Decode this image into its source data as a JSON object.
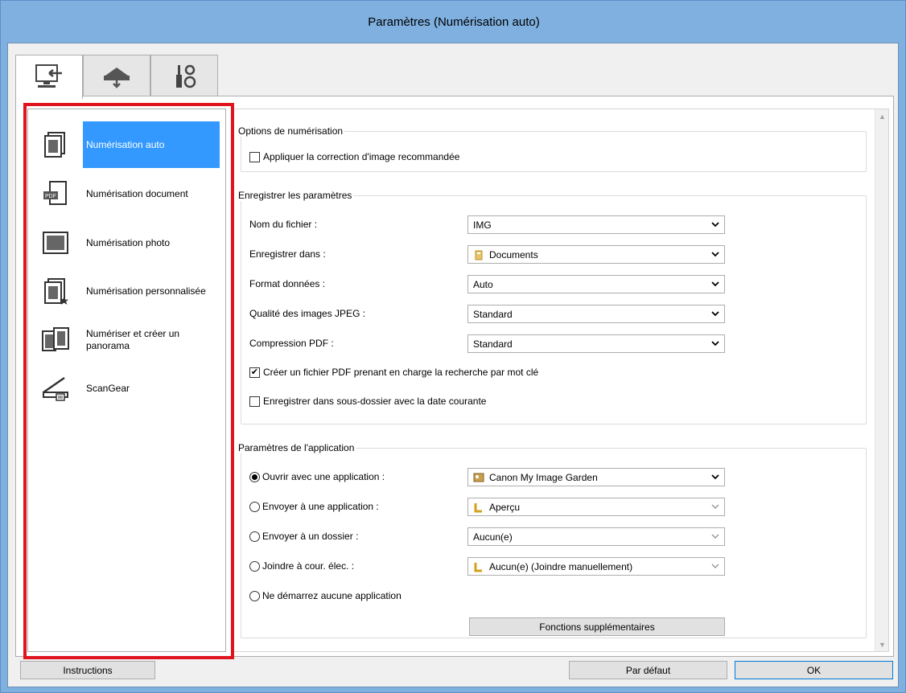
{
  "window": {
    "title": "Paramètres (Numérisation auto)"
  },
  "tabs": [
    {
      "icon": "computer-scan-icon",
      "active": true
    },
    {
      "icon": "scanner-icon",
      "active": false
    },
    {
      "icon": "tools-icon",
      "active": false
    }
  ],
  "modes": [
    {
      "label": "Numérisation auto",
      "icon": "auto-scan-icon",
      "selected": true
    },
    {
      "label": "Numérisation document",
      "icon": "document-scan-icon",
      "selected": false
    },
    {
      "label": "Numérisation photo",
      "icon": "photo-scan-icon",
      "selected": false
    },
    {
      "label": "Numérisation personnalisée",
      "icon": "custom-scan-icon",
      "selected": false
    },
    {
      "label": "Numériser et créer un panorama",
      "icon": "panorama-icon",
      "selected": false
    },
    {
      "label": "ScanGear",
      "icon": "scangear-icon",
      "selected": false
    }
  ],
  "scan_options": {
    "legend": "Options de numérisation",
    "apply_correction": {
      "label": "Appliquer la correction d'image recommandée",
      "checked": false
    }
  },
  "save_settings": {
    "legend": "Enregistrer les paramètres",
    "file_name": {
      "label": "Nom du fichier :",
      "value": "IMG"
    },
    "save_in": {
      "label": "Enregistrer dans :",
      "value": "Documents"
    },
    "data_format": {
      "label": "Format données :",
      "value": "Auto"
    },
    "jpeg_quality": {
      "label": "Qualité des images JPEG :",
      "value": "Standard"
    },
    "pdf_compression": {
      "label": "Compression PDF :",
      "value": "Standard"
    },
    "searchable_pdf": {
      "label": "Créer un fichier PDF prenant en charge la recherche par mot clé",
      "checked": true
    },
    "subfolder_date": {
      "label": "Enregistrer dans sous-dossier avec la date courante",
      "checked": false
    }
  },
  "app_settings": {
    "legend": "Paramètres de l'application",
    "open_with_app": {
      "label": "Ouvrir avec une application :",
      "value": "Canon My Image Garden",
      "selected": true
    },
    "send_to_app": {
      "label": "Envoyer à une application :",
      "value": "Aperçu",
      "selected": false
    },
    "send_to_folder": {
      "label": "Envoyer à un dossier :",
      "value": "Aucun(e)",
      "selected": false
    },
    "attach_email": {
      "label": "Joindre à cour. élec. :",
      "value": "Aucun(e) (Joindre manuellement)",
      "selected": false
    },
    "no_app": {
      "label": "Ne démarrez aucune application",
      "selected": false
    },
    "more_functions": "Fonctions supplémentaires"
  },
  "buttons": {
    "instructions": "Instructions",
    "default": "Par défaut",
    "ok": "OK"
  },
  "colors": {
    "selection": "#3399ff",
    "highlight_frame": "#e0141e",
    "title_bar": "#7fb0e0"
  }
}
